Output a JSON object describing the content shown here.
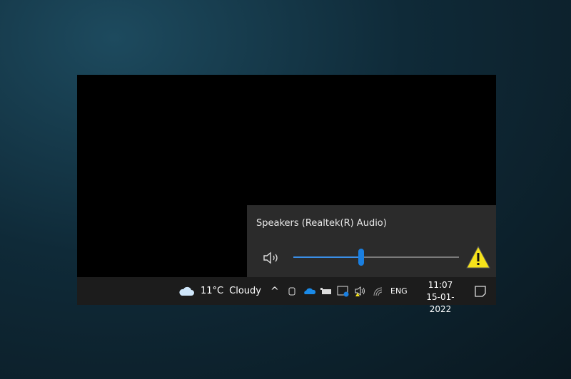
{
  "flyout": {
    "device_name": "Speakers (Realtek(R) Audio)",
    "volume_fraction": 0.41
  },
  "taskbar": {
    "weather_temp": "11°C",
    "weather_desc": "Cloudy",
    "language": "ENG",
    "time": "11:07",
    "date": "15-01-2022"
  },
  "colors": {
    "accent": "#1a7fe0",
    "warning": "#f5e21a"
  }
}
